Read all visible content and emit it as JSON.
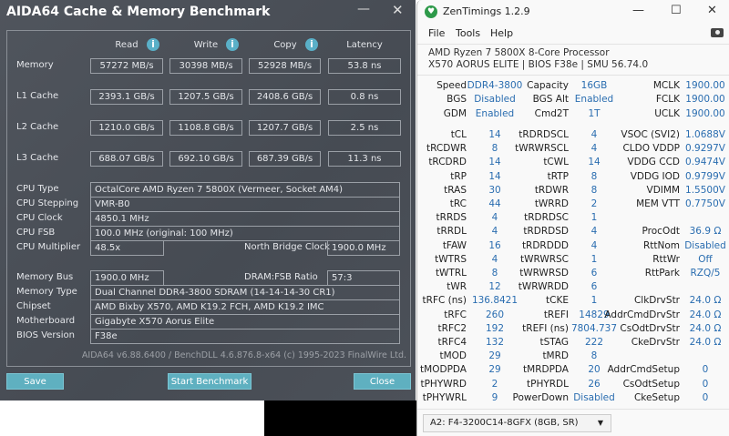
{
  "aida": {
    "title": "AIDA64 Cache & Memory Benchmark",
    "min_glyph": "—",
    "close_glyph": "✕",
    "headers": [
      "Read",
      "Write",
      "Copy",
      "Latency"
    ],
    "bench": [
      {
        "label": "Memory",
        "values": [
          "57272 MB/s",
          "30398 MB/s",
          "52928 MB/s",
          "53.8 ns"
        ]
      },
      {
        "label": "L1 Cache",
        "values": [
          "2393.1 GB/s",
          "1207.5 GB/s",
          "2408.6 GB/s",
          "0.8 ns"
        ]
      },
      {
        "label": "L2 Cache",
        "values": [
          "1210.0 GB/s",
          "1108.8 GB/s",
          "1207.7 GB/s",
          "2.5 ns"
        ]
      },
      {
        "label": "L3 Cache",
        "values": [
          "688.07 GB/s",
          "692.10 GB/s",
          "687.39 GB/s",
          "11.3 ns"
        ]
      }
    ],
    "info": {
      "cpu_type_label": "CPU Type",
      "cpu_type": "OctalCore AMD Ryzen 7 5800X  (Vermeer, Socket AM4)",
      "cpu_stepping_label": "CPU Stepping",
      "cpu_stepping": "VMR-B0",
      "cpu_clock_label": "CPU Clock",
      "cpu_clock": "4850.1 MHz",
      "cpu_fsb_label": "CPU FSB",
      "cpu_fsb": "100.0 MHz  (original: 100 MHz)",
      "cpu_mult_label": "CPU Multiplier",
      "cpu_mult": "48.5x",
      "nb_clock_label": "North Bridge Clock",
      "nb_clock": "1900.0 MHz",
      "mem_bus_label": "Memory Bus",
      "mem_bus": "1900.0 MHz",
      "dram_ratio_label": "DRAM:FSB Ratio",
      "dram_ratio": "57:3",
      "mem_type_label": "Memory Type",
      "mem_type": "Dual Channel DDR4-3800 SDRAM  (14-14-14-30 CR1)",
      "chipset_label": "Chipset",
      "chipset": "AMD Bixby X570, AMD K19.2 FCH, AMD K19.2 IMC",
      "mobo_label": "Motherboard",
      "mobo": "Gigabyte X570 Aorus Elite",
      "bios_label": "BIOS Version",
      "bios": "F38e"
    },
    "footer": "AIDA64 v6.88.6400 / BenchDLL 4.6.876.8-x64  (c) 1995-2023 FinalWire Ltd.",
    "buttons": {
      "save": "Save",
      "start": "Start Benchmark",
      "close": "Close"
    },
    "colors": {
      "accent": "#5fb0c0"
    }
  },
  "zen": {
    "title": "ZenTimings 1.2.9",
    "menu": [
      "File",
      "Tools",
      "Help"
    ],
    "cpu": "AMD Ryzen 7 5800X 8-Core Processor",
    "board": "X570 AORUS ELITE | BIOS F38e | SMU 56.74.0",
    "top": [
      [
        [
          "Speed",
          "DDR4-3800"
        ],
        [
          "Capacity",
          "16GB"
        ],
        [
          "MCLK",
          "1900.00"
        ]
      ],
      [
        [
          "BGS",
          "Disabled"
        ],
        [
          "BGS Alt",
          "Enabled"
        ],
        [
          "FCLK",
          "1900.00"
        ]
      ],
      [
        [
          "GDM",
          "Enabled"
        ],
        [
          "Cmd2T",
          "1T"
        ],
        [
          "UCLK",
          "1900.00"
        ]
      ]
    ],
    "rows": [
      [
        [
          "tCL",
          "14"
        ],
        [
          "tRDRDSCL",
          "4"
        ],
        [
          "VSOC (SVI2)",
          "1.0688V"
        ]
      ],
      [
        [
          "tRCDWR",
          "8"
        ],
        [
          "tWRWRSCL",
          "4"
        ],
        [
          "CLDO VDDP",
          "0.9297V"
        ]
      ],
      [
        [
          "tRCDRD",
          "14"
        ],
        [
          "tCWL",
          "14"
        ],
        [
          "VDDG CCD",
          "0.9474V"
        ]
      ],
      [
        [
          "tRP",
          "14"
        ],
        [
          "tRTP",
          "8"
        ],
        [
          "VDDG IOD",
          "0.9799V"
        ]
      ],
      [
        [
          "tRAS",
          "30"
        ],
        [
          "tRDWR",
          "8"
        ],
        [
          "VDIMM",
          "1.5500V"
        ]
      ],
      [
        [
          "tRC",
          "44"
        ],
        [
          "tWRRD",
          "2"
        ],
        [
          "MEM VTT",
          "0.7750V"
        ]
      ],
      [
        [
          "tRRDS",
          "4"
        ],
        [
          "tRDRDSC",
          "1"
        ],
        [
          "",
          ""
        ]
      ],
      [
        [
          "tRRDL",
          "4"
        ],
        [
          "tRDRDSD",
          "4"
        ],
        [
          "ProcOdt",
          "36.9 Ω"
        ]
      ],
      [
        [
          "tFAW",
          "16"
        ],
        [
          "tRDRDDD",
          "4"
        ],
        [
          "RttNom",
          "Disabled"
        ]
      ],
      [
        [
          "tWTRS",
          "4"
        ],
        [
          "tWRWRSC",
          "1"
        ],
        [
          "RttWr",
          "Off"
        ]
      ],
      [
        [
          "tWTRL",
          "8"
        ],
        [
          "tWRWRSD",
          "6"
        ],
        [
          "RttPark",
          "RZQ/5"
        ]
      ],
      [
        [
          "tWR",
          "12"
        ],
        [
          "tWRWRDD",
          "6"
        ],
        [
          "",
          ""
        ]
      ],
      [
        [
          "tRFC (ns)",
          "136.8421"
        ],
        [
          "tCKE",
          "1"
        ],
        [
          "ClkDrvStr",
          "24.0 Ω"
        ]
      ],
      [
        [
          "tRFC",
          "260"
        ],
        [
          "tREFI",
          "14829"
        ],
        [
          "AddrCmdDrvStr",
          "24.0 Ω"
        ]
      ],
      [
        [
          "tRFC2",
          "192"
        ],
        [
          "tREFI (ns)",
          "7804.737"
        ],
        [
          "CsOdtDrvStr",
          "24.0 Ω"
        ]
      ],
      [
        [
          "tRFC4",
          "132"
        ],
        [
          "tSTAG",
          "222"
        ],
        [
          "CkeDrvStr",
          "24.0 Ω"
        ]
      ],
      [
        [
          "tMOD",
          "29"
        ],
        [
          "tMRD",
          "8"
        ],
        [
          "",
          ""
        ]
      ],
      [
        [
          "tMODPDA",
          "29"
        ],
        [
          "tMRDPDA",
          "20"
        ],
        [
          "AddrCmdSetup",
          "0"
        ]
      ],
      [
        [
          "tPHYWRD",
          "2"
        ],
        [
          "tPHYRDL",
          "26"
        ],
        [
          "CsOdtSetup",
          "0"
        ]
      ],
      [
        [
          "tPHYWRL",
          "9"
        ],
        [
          "PowerDown",
          "Disabled"
        ],
        [
          "CkeSetup",
          "0"
        ]
      ]
    ],
    "dimm": "A2: F4-3200C14-8GFX (8GB, SR)",
    "colors": {
      "value": "#2a6db0",
      "logo": "#2e9a4a"
    }
  }
}
